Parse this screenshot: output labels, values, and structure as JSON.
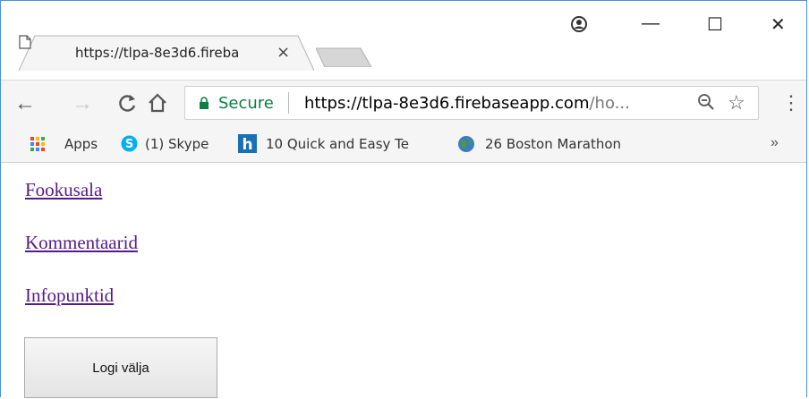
{
  "browser": {
    "tab": {
      "title": "https://tlpa-8e3d6.fireba",
      "close_symbol": "×"
    },
    "window_controls": {
      "profile": "⊙",
      "minimize": "—",
      "maximize": "☐",
      "close": "✕"
    },
    "toolbar": {
      "back": "←",
      "forward": "→",
      "reload": "C",
      "home": "⌂",
      "secure_label": "Secure",
      "url_host": "https://tlpa-8e3d6.firebaseapp.com",
      "url_rest": "/ho...",
      "zoom_icon": "search-minus-icon",
      "bookmark_icon": "star-icon",
      "menu_icon": "⋮"
    },
    "bookmarks": [
      {
        "label": "Apps",
        "icon": "apps-grid-icon"
      },
      {
        "label": "(1) Skype",
        "icon": "skype-icon"
      },
      {
        "label": "10 Quick and Easy Te",
        "icon": "h-icon"
      },
      {
        "label": "26 Boston Marathon",
        "icon": "globe-icon"
      }
    ],
    "bookmarks_overflow": "»"
  },
  "page": {
    "links": [
      "Fookusala",
      "Kommentaarid",
      "Infopunktid"
    ],
    "logout_button": "Logi välja"
  },
  "colors": {
    "link_visited": "#551a8b",
    "secure_green": "#0b8043",
    "window_border": "#4a90d9"
  }
}
